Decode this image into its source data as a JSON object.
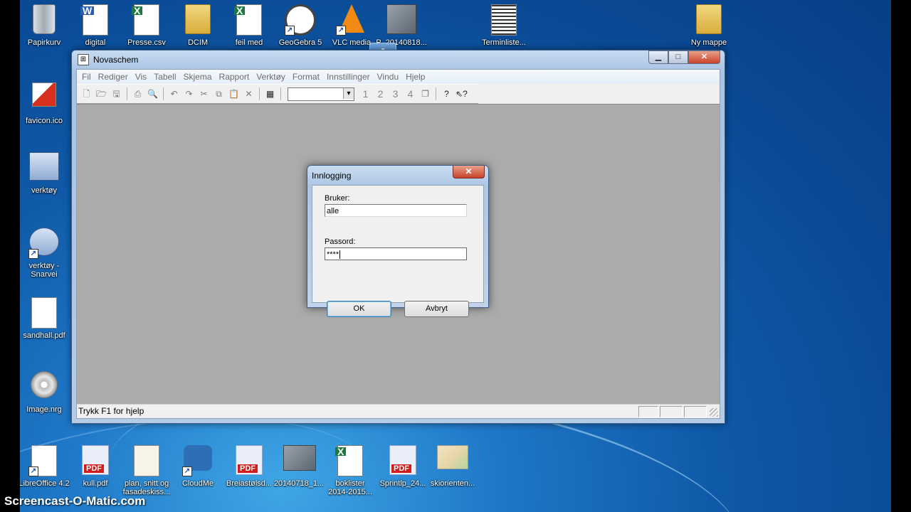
{
  "desktop": {
    "icons_top": [
      {
        "label": "Papirkurv",
        "icon": "recycle-bin-icon"
      },
      {
        "label": "digital",
        "icon": "word-doc-icon"
      },
      {
        "label": "Presse.csv",
        "icon": "csv-file-icon"
      },
      {
        "label": "DCIM",
        "icon": "folder-icon"
      },
      {
        "label": "feil med",
        "icon": "excel-file-icon"
      },
      {
        "label": "GeoGebra 5",
        "icon": "geogebra-icon"
      },
      {
        "label": "VLC media",
        "icon": "vlc-icon"
      },
      {
        "label": "P_20140818...",
        "icon": "image-thumb-icon"
      },
      {
        "label": "Terminliste...",
        "icon": "document-thumb-icon"
      },
      {
        "label": "Ny mappe",
        "icon": "folder-icon"
      }
    ],
    "icons_left": [
      {
        "label": "favicon.ico",
        "icon": "favicon-icon"
      },
      {
        "label": "verktøy",
        "icon": "tools-icon"
      },
      {
        "label": "verktøy - Snarvei",
        "icon": "shortcut-icon"
      },
      {
        "label": "sandhall.pdf",
        "icon": "pdf-doc-icon"
      },
      {
        "label": "Image.nrg",
        "icon": "disc-image-icon"
      }
    ],
    "icons_bottom": [
      {
        "label": "LibreOffice 4.2",
        "icon": "libreoffice-icon"
      },
      {
        "label": "kull.pdf",
        "icon": "pdf-icon"
      },
      {
        "label": "plan, snitt og fasadeskiss...",
        "icon": "drawing-thumb-icon"
      },
      {
        "label": "CloudMe",
        "icon": "cloudme-icon"
      },
      {
        "label": "Breiastølsd...",
        "icon": "pdf-icon"
      },
      {
        "label": "20140718_1...",
        "icon": "photo-thumb-icon"
      },
      {
        "label": "boklister 2014-2015...",
        "icon": "excel-file-icon"
      },
      {
        "label": "Sprintlp_24...",
        "icon": "pdf-icon"
      },
      {
        "label": "skiorienten...",
        "icon": "map-thumb-icon"
      }
    ]
  },
  "window": {
    "title": "Novaschem",
    "menu": [
      "Fil",
      "Rediger",
      "Vis",
      "Tabell",
      "Skjema",
      "Rapport",
      "Verktøy",
      "Format",
      "Innstillinger",
      "Vindu",
      "Hjelp"
    ],
    "toolbar_numbers": [
      "1",
      "2",
      "3",
      "4"
    ],
    "status": "Trykk F1 for hjelp"
  },
  "dialog": {
    "title": "Innlogging",
    "user_label": "Bruker:",
    "user_value": "alle",
    "password_label": "Passord:",
    "password_value": "****",
    "ok": "OK",
    "cancel": "Avbryt"
  },
  "watermark": "Screencast-O-Matic.com",
  "colors": {
    "desktop": "#1f78c8",
    "mdi_background": "#ababab",
    "close_button": "#c8432a"
  }
}
